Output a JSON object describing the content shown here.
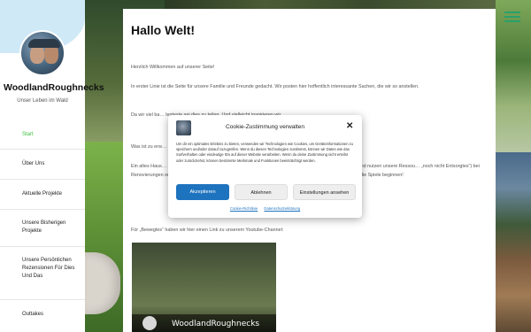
{
  "site": {
    "title": "WoodlandRoughnecks",
    "tagline": "Unser Leben im Wald"
  },
  "nav": {
    "items": [
      {
        "label": "Start",
        "active": true
      },
      {
        "label": "Über Uns"
      },
      {
        "label": "Aktuelle Projekte"
      },
      {
        "label": "Unsere Bisherigen Projekte"
      },
      {
        "label": "Unsere Persönlichen Rezensionen Für Dies Und Das"
      },
      {
        "label": "Outtakes"
      }
    ]
  },
  "page": {
    "title": "Hallo Welt!",
    "paragraphs": [
      "Herzlich Willkommen auf unserer Seite!",
      "In erster Linie ist die Seite für unsere Familie und Freunde gedacht. Wir posten hier hoffentlich interessante Sachen, die wir so anstellen.",
      "Da wir viel ba… lenteste sei dies zu teilen. Und vielleicht inspirieren wir…",
      "Was ist zu erw…",
      "Ein altes Haus… sante Werkzeuge und Tools und recht viele Upcycling-Pro… en uns ganz, ganz viel Mühe und nutzen unsere Ressou… „noch nicht Entsorgtes“) bei Renovierungen oder für unser… daran ist das, was uns am meisten fasziniert. Ein erklärtes Z… Also mögen die Spiele beginnen!",
      "Für „Bewegtes“ haben wir hier einen Link zu unserem Youtube-Channel:"
    ],
    "video_channel": "WoodlandRoughnecks"
  },
  "cookie": {
    "title": "Cookie-Zustimmung verwalten",
    "close": "✕",
    "text": "Um dir ein optimales Erlebnis zu bieten, verwenden wir Technologien wie Cookies, um Geräteinformationen zu speichern und/oder darauf zuzugreifen. Wenn du diesen Technologien zustimmst, können wir Daten wie das Surfverhalten oder eindeutige IDs auf dieser Website verarbeiten. Wenn du deine Zustimmung nicht erteilst oder zurückziehst, können bestimmte Merkmale und Funktionen beeinträchtigt werden.",
    "accept": "Akzeptieren",
    "deny": "Ablehnen",
    "settings": "Einstellungen ansehen",
    "link_cookie": "Cookie-Richtlinie",
    "link_privacy": "Datenschutzerklärung"
  },
  "colors": {
    "accent_green": "#3fbf3f",
    "button_blue": "#1e73be",
    "sidebar_blob": "#cfe9f7"
  }
}
